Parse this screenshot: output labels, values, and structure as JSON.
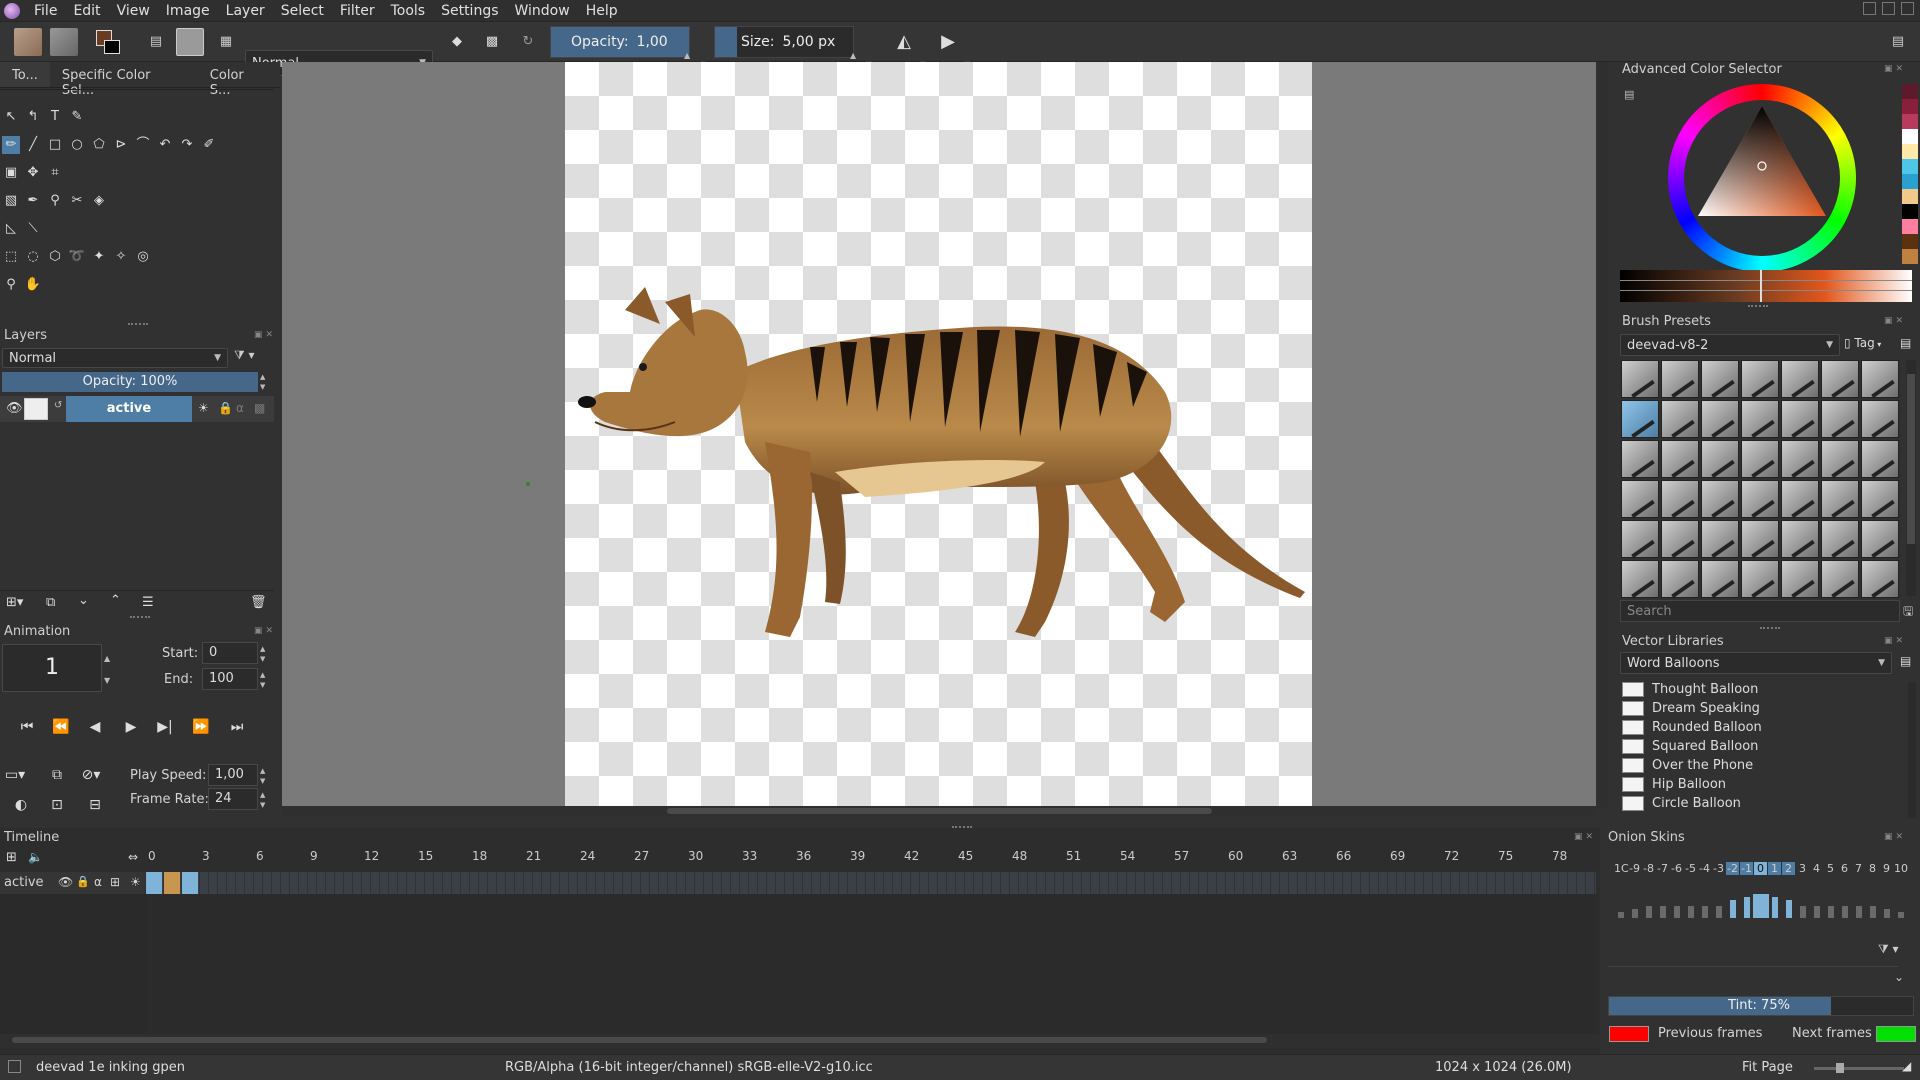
{
  "menu": [
    "File",
    "Edit",
    "View",
    "Image",
    "Layer",
    "Select",
    "Filter",
    "Tools",
    "Settings",
    "Window",
    "Help"
  ],
  "toolbar": {
    "blend_mode": "Normal",
    "opacity_label": "Opacity:",
    "opacity_value": "1,00",
    "size_label": "Size:",
    "size_value": "5,00 px"
  },
  "toolbox": {
    "tabs": [
      "To...",
      "Specific Color Sel...",
      "Color S..."
    ]
  },
  "layers": {
    "title": "Layers",
    "blend_mode": "Normal",
    "opacity": "Opacity:  100%",
    "layer_name": "active"
  },
  "animation": {
    "title": "Animation",
    "current_frame": "1",
    "start_label": "Start:",
    "start_value": "0",
    "end_label": "End:",
    "end_value": "100",
    "speed_label": "Play Speed:",
    "speed_value": "1,00",
    "rate_label": "Frame Rate:",
    "rate_value": "24"
  },
  "color_selector": {
    "title": "Advanced Color Selector",
    "palette": [
      "#5c1a2a",
      "#8a1f3c",
      "#b83a5c",
      "#ffffff",
      "#ffe9a8",
      "#4ec6e8",
      "#2aa0d0",
      "#f1c98a",
      "#000000",
      "#ff7fa0",
      "#5a3210",
      "#c08040"
    ]
  },
  "brush_presets": {
    "title": "Brush Presets",
    "tag_combo": "deevad-v8-2",
    "tag_button": "Tag",
    "search_placeholder": "Search"
  },
  "vector_libraries": {
    "title": "Vector Libraries",
    "library": "Word Balloons",
    "items": [
      "Thought Balloon",
      "Dream Speaking",
      "Rounded Balloon",
      "Squared Balloon",
      "Over the Phone",
      "Hip Balloon",
      "Circle Balloon"
    ]
  },
  "timeline": {
    "title": "Timeline",
    "layer_name": "active",
    "frame_numbers": [
      "0",
      "3",
      "6",
      "9",
      "12",
      "15",
      "18",
      "21",
      "24",
      "27",
      "30",
      "33",
      "36",
      "39",
      "42",
      "45",
      "48",
      "51",
      "54",
      "57",
      "60",
      "63",
      "66",
      "69",
      "72",
      "75",
      "78"
    ]
  },
  "onion_skins": {
    "title": "Onion Skins",
    "numbers": [
      "1C",
      "-9",
      "-8",
      "-7",
      "-6",
      "-5",
      "-4",
      "-3",
      "-2",
      "-1",
      "0",
      "1",
      "2",
      "3",
      "4",
      "5",
      "6",
      "7",
      "8",
      "9",
      "10"
    ],
    "tint": "Tint: 75%",
    "prev_label": "Previous frames",
    "next_label": "Next frames",
    "prev_color": "#ff0000",
    "next_color": "#00e000"
  },
  "status": {
    "brush": "deevad 1e inking gpen",
    "color_space": "RGB/Alpha (16-bit integer/channel)  sRGB-elle-V2-g10.icc",
    "dimensions": "1024 x 1024 (26.0M)",
    "zoom_label": "Fit Page"
  },
  "colors": {
    "accent": "#4e7ea6",
    "highlight": "#7fb3d8"
  }
}
